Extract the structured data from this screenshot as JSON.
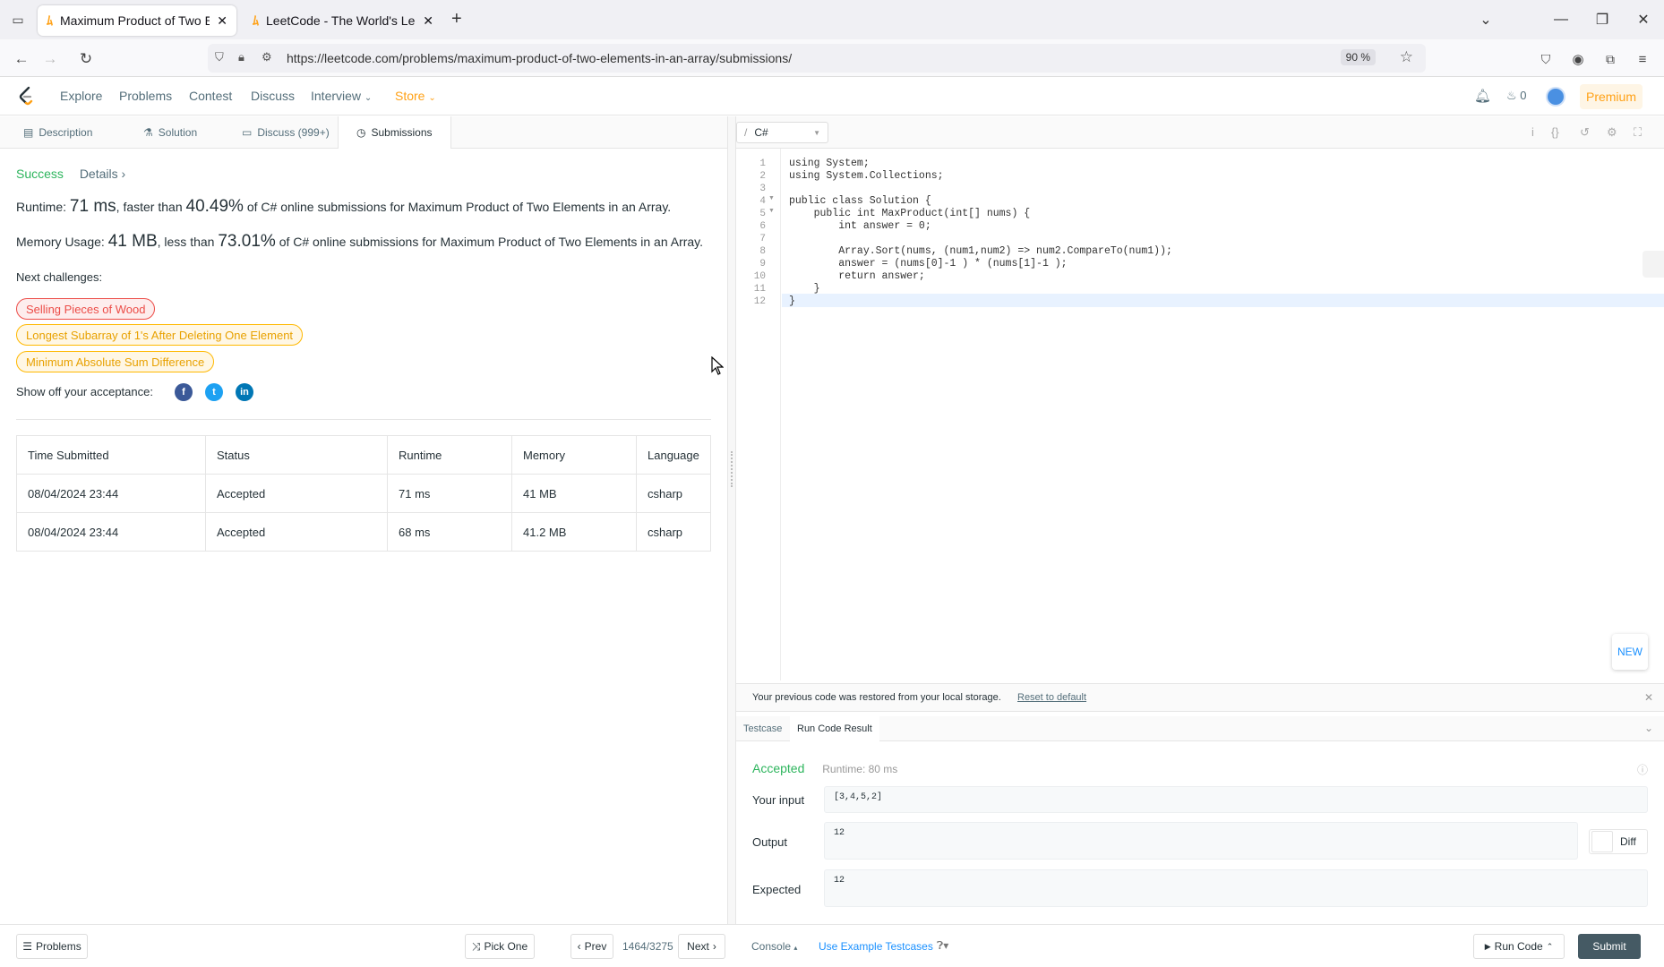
{
  "browser": {
    "tabs": [
      {
        "title": "Maximum Product of Two Elen",
        "active": true
      },
      {
        "title": "LeetCode - The World's Leadi",
        "active": false
      }
    ],
    "url": "https://leetcode.com/problems/maximum-product-of-two-elements-in-an-array/submissions/",
    "zoom": "90 %"
  },
  "header": {
    "nav": [
      "Explore",
      "Problems",
      "Contest",
      "Discuss",
      "Interview",
      "Store"
    ],
    "streak_count": "0",
    "premium_label": "Premium"
  },
  "subtabs": [
    "Description",
    "Solution",
    "Discuss (999+)",
    "Submissions"
  ],
  "result": {
    "status": "Success",
    "details_label": "Details",
    "runtime_prefix": "Runtime:",
    "runtime_value": "71 ms",
    "runtime_mid": ", faster than",
    "runtime_pct": "40.49%",
    "runtime_suffix": "of C# online submissions for Maximum Product of Two Elements in an Array.",
    "memory_prefix": "Memory Usage:",
    "memory_value": "41 MB",
    "memory_mid": ", less than",
    "memory_pct": "73.01%",
    "memory_suffix": "of C# online submissions for Maximum Product of Two Elements in an Array.",
    "next_label": "Next challenges:",
    "challenges": [
      "Selling Pieces of Wood",
      "Longest Subarray of 1's After Deleting One Element",
      "Minimum Absolute Sum Difference"
    ],
    "share_label": "Show off your acceptance:"
  },
  "table": {
    "headers": [
      "Time Submitted",
      "Status",
      "Runtime",
      "Memory",
      "Language"
    ],
    "rows": [
      [
        "08/04/2024 23:44",
        "Accepted",
        "71 ms",
        "41 MB",
        "csharp"
      ],
      [
        "08/04/2024 23:44",
        "Accepted",
        "68 ms",
        "41.2 MB",
        "csharp"
      ]
    ]
  },
  "editor": {
    "language": "C#",
    "lines": [
      "using System;",
      "using System.Collections;",
      "",
      "public class Solution {",
      "    public int MaxProduct(int[] nums) {",
      "        int answer = 0;",
      "",
      "        Array.Sort(nums, (num1,num2) => num2.CompareTo(num1));",
      "        answer = (nums[0]-1 ) * (nums[1]-1 );",
      "        return answer;",
      "    }",
      "}"
    ],
    "line_numbers": [
      "1",
      "2",
      "3",
      "4",
      "5",
      "6",
      "7",
      "8",
      "9",
      "10",
      "11",
      "12"
    ],
    "new_label": "NEW"
  },
  "console": {
    "restore_msg": "Your previous code was restored from your local storage.",
    "reset_link": "Reset to default",
    "tabs": [
      "Testcase",
      "Run Code Result"
    ],
    "status": "Accepted",
    "runtime": "Runtime: 80 ms",
    "input_label": "Your input",
    "input_value": "[3,4,5,2]",
    "output_label": "Output",
    "output_value": "12",
    "expected_label": "Expected",
    "expected_value": "12",
    "diff_label": "Diff"
  },
  "bottom": {
    "problems": "Problems",
    "pick_one": "Pick One",
    "prev": "Prev",
    "page": "1464/3275",
    "next": "Next",
    "console": "Console",
    "use_example": "Use Example Testcases",
    "run_code": "Run Code",
    "submit": "Submit"
  }
}
